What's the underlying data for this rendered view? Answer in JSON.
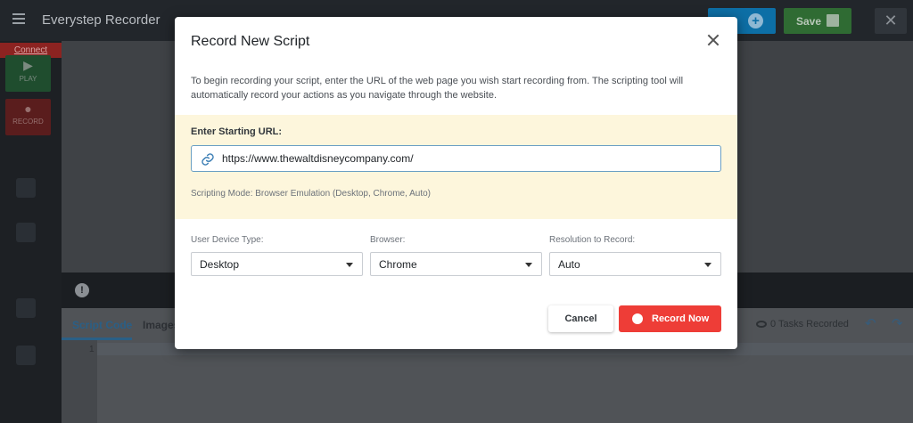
{
  "app": {
    "title": "Everystep Recorder",
    "new_label": "",
    "save_label": "Save",
    "connect_label": "Connect"
  },
  "sidebar": {
    "play_label": "PLAY",
    "record_label": "RECORD"
  },
  "bottom": {
    "tabs": [
      {
        "label": "Script Code",
        "active": true
      },
      {
        "label": "Images",
        "active": false
      }
    ],
    "tasks_recorded": "0 Tasks Recorded",
    "line_number": "1"
  },
  "modal": {
    "title": "Record New Script",
    "description": "To begin recording your script, enter the URL of the web page you wish start recording from. The scripting tool will automatically record your actions as you navigate through the website.",
    "url_label": "Enter Starting URL:",
    "url_value": "https://www.thewaltdisneycompany.com/",
    "scripting_mode": "Scripting Mode: Browser Emulation (Desktop, Chrome, Auto)",
    "device": {
      "label": "User Device Type:",
      "value": "Desktop"
    },
    "browser": {
      "label": "Browser:",
      "value": "Chrome"
    },
    "resolution": {
      "label": "Resolution to Record:",
      "value": "Auto"
    },
    "cancel_label": "Cancel",
    "record_label": "Record Now"
  },
  "colors": {
    "primary_blue": "#0d6fa6",
    "save_green": "#2f6b33",
    "record_red": "#ee3d37",
    "url_section_bg": "#fdf6dc"
  },
  "icons": {
    "menu": "hamburger-icon",
    "add": "plus-circle-icon",
    "save": "floppy-disk-icon",
    "close": "close-icon",
    "link": "link-icon",
    "info": "info-icon",
    "eye": "eye-icon",
    "undo": "undo-icon",
    "redo": "redo-icon"
  }
}
